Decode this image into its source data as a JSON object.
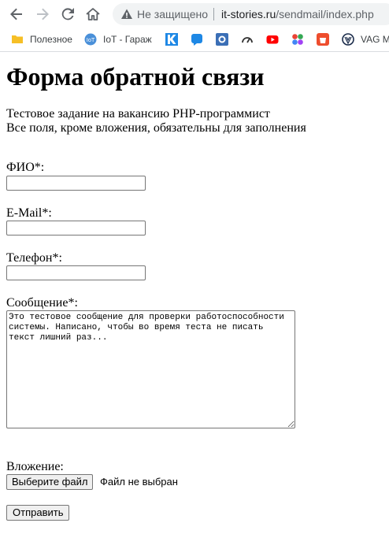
{
  "browser": {
    "omnibox_insecure_label": "Не защищено",
    "url_host": "it-stories.ru",
    "url_path": "/sendmail/index.php",
    "bookmarks": [
      {
        "label": "Полезное",
        "icon": "folder-icon",
        "color": "#f6bf26"
      },
      {
        "label": "IoT - Гараж",
        "icon": "iot-icon",
        "color": "#4a90d9"
      },
      {
        "label": "",
        "icon": "k-icon",
        "color": "#1e88e5"
      },
      {
        "label": "",
        "icon": "chat-icon",
        "color": "#1e88e5"
      },
      {
        "label": "",
        "icon": "gear-app-icon",
        "color": "#3b6fb6"
      },
      {
        "label": "",
        "icon": "speedometer-icon",
        "color": "#333333"
      },
      {
        "label": "",
        "icon": "youtube-icon",
        "color": "#ff0000"
      },
      {
        "label": "",
        "icon": "colorful-dots-icon",
        "color": "#ea4335"
      },
      {
        "label": "",
        "icon": "shop-icon",
        "color": "#ee4d2d"
      },
      {
        "label": "VAG M",
        "icon": "vw-icon",
        "color": "#1a2b4a"
      }
    ]
  },
  "page": {
    "title": "Форма обратной связи",
    "description_line1": "Тестовое задание на вакансию PHP-программист",
    "description_line2": "Все поля, кроме вложения, обязательны для заполнения",
    "fio_label": "ФИО*:",
    "fio_value": "",
    "email_label": "E-Mail*:",
    "email_value": "",
    "phone_label": "Телефон*:",
    "phone_value": "",
    "message_label": "Сообщение*:",
    "message_value": "Это тестовое сообщение для проверки работоспособности системы. Написано, чтобы во время теста не писать текст лишний раз...",
    "attachment_label": "Вложение:",
    "file_button_label": "Выберите файл",
    "file_status": "Файл не выбран",
    "submit_label": "Отправить"
  }
}
